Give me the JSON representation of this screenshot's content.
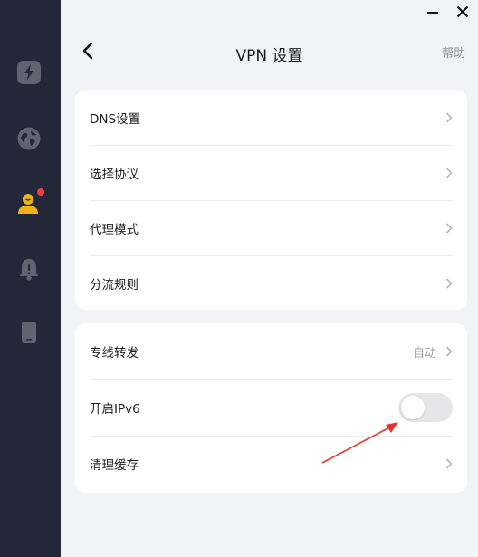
{
  "header": {
    "title": "VPN 设置",
    "help": "帮助"
  },
  "sidebar": {
    "items": [
      {
        "icon": "lightning-icon"
      },
      {
        "icon": "globe-icon"
      },
      {
        "icon": "user-icon",
        "badge": true
      },
      {
        "icon": "bell-icon"
      },
      {
        "icon": "phone-icon"
      }
    ]
  },
  "settings_group1": [
    {
      "label": "DNS设置"
    },
    {
      "label": "选择协议"
    },
    {
      "label": "代理模式"
    },
    {
      "label": "分流规则"
    }
  ],
  "settings_group2": {
    "dedicated": {
      "label": "专线转发",
      "value": "自动"
    },
    "ipv6": {
      "label": "开启IPv6",
      "enabled": false
    },
    "clear_cache": {
      "label": "清理缓存"
    }
  },
  "colors": {
    "sidebar_bg": "#222837",
    "accent": "#f3b21b",
    "badge": "#f23b3b",
    "annotation_arrow": "#e0392b"
  }
}
